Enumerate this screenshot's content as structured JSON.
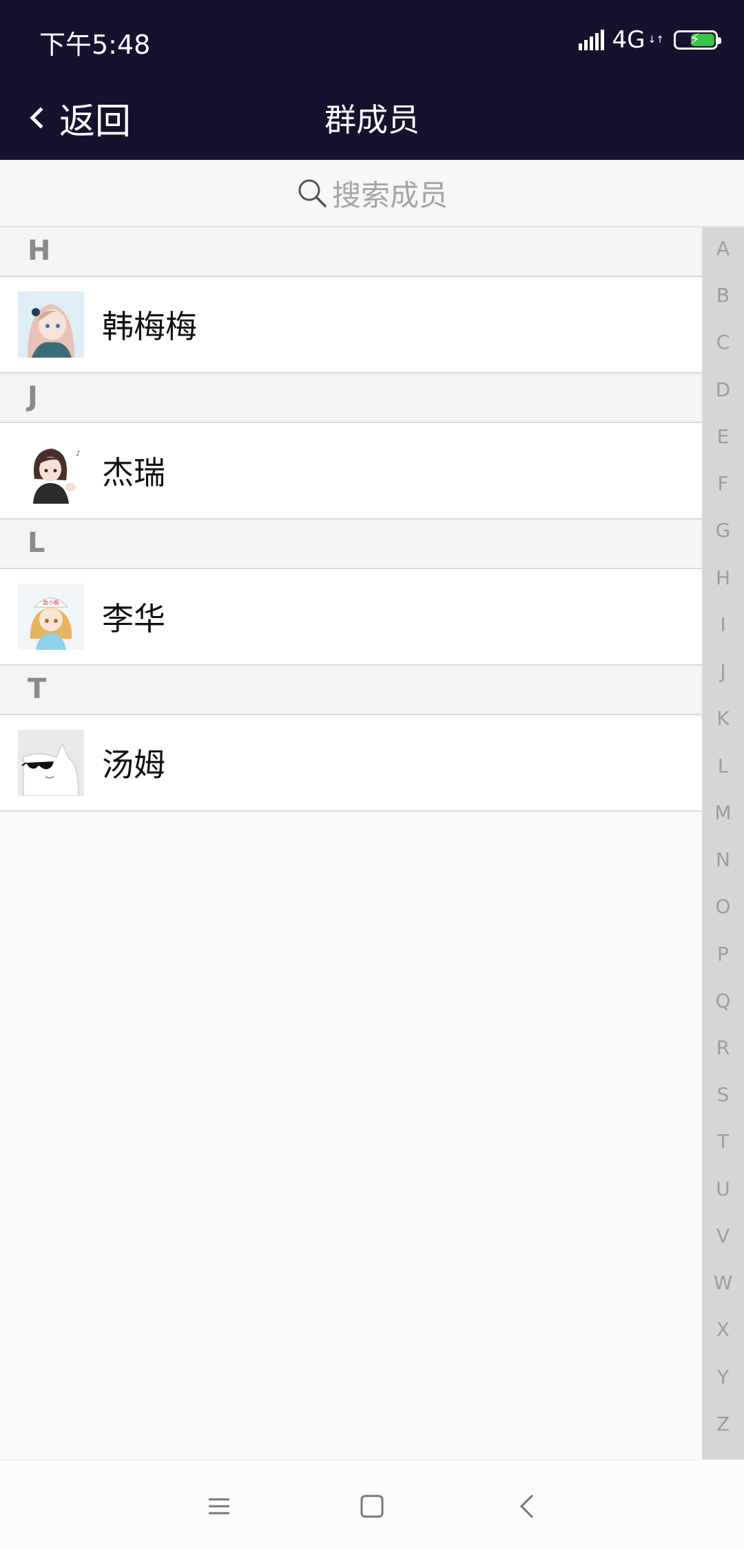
{
  "status": {
    "time": "下午5:48",
    "network": "4G",
    "network_sub": "4G↓↑"
  },
  "nav": {
    "back_label": "返回",
    "title": "群成员"
  },
  "search": {
    "placeholder": "搜索成员"
  },
  "sections": [
    {
      "letter": "H",
      "members": [
        {
          "name": "韩梅梅",
          "avatar": "anime-girl-pink-hair-avatar"
        }
      ]
    },
    {
      "letter": "J",
      "members": [
        {
          "name": "杰瑞",
          "avatar": "anime-girl-dark-hair-avatar"
        }
      ]
    },
    {
      "letter": "L",
      "members": [
        {
          "name": "李华",
          "avatar": "anime-girl-blue-shirt-avatar"
        }
      ]
    },
    {
      "letter": "T",
      "members": [
        {
          "name": "汤姆",
          "avatar": "cat-with-sunglasses-avatar"
        }
      ]
    }
  ],
  "index_letters": [
    "A",
    "B",
    "C",
    "D",
    "E",
    "F",
    "G",
    "H",
    "I",
    "J",
    "K",
    "L",
    "M",
    "N",
    "O",
    "P",
    "Q",
    "R",
    "S",
    "T",
    "U",
    "V",
    "W",
    "X",
    "Y",
    "Z"
  ],
  "colors": {
    "header_bg": "#17112f",
    "battery": "#35c744",
    "index_bg": "#d6d6d6"
  }
}
